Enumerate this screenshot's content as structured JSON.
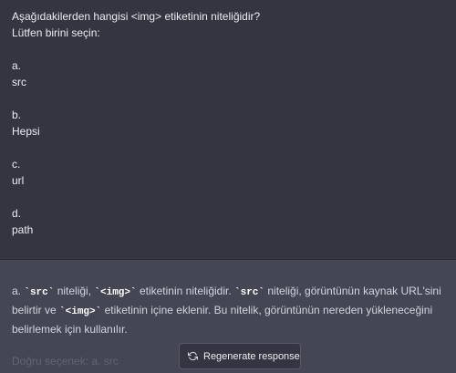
{
  "question": {
    "title": "Aşağıdakilerden hangisi <img> etiketinin niteliğidir?",
    "instruction": "Lütfen birini seçin:",
    "options": [
      {
        "letter": "a.",
        "text": "src"
      },
      {
        "letter": "b.",
        "text": "Hepsi"
      },
      {
        "letter": "c.",
        "text": "url"
      },
      {
        "letter": "d.",
        "text": "path"
      }
    ]
  },
  "answer": {
    "line1": {
      "p1": "a. ",
      "c1": "`src`",
      "p2": " niteliği, ",
      "c2": "`<img>`",
      "p3": " etiketinin niteliğidir. ",
      "c3": "`src`",
      "p4": " niteliği, görüntünün kaynak URL'sini"
    },
    "line2": {
      "p1": "belirtir ve ",
      "c1": "`<img>`",
      "p2": " etiketinin içine eklenir. Bu nitelik, görüntünün nereden yükleneceğini"
    },
    "line3": "belirlemek için kullanılır.",
    "final": "Doğru seçenek: a. src"
  },
  "controls": {
    "regenerate_label": "Regenerate response",
    "regenerate_icon": "refresh-icon"
  }
}
